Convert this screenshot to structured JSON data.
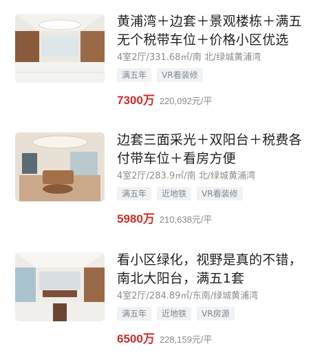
{
  "listings": [
    {
      "title": "黄浦湾＋边套＋景观楼栋＋满五无个税带车位＋价格小区优选",
      "meta": "4室2厅/331.68㎡/南 北/绿城黄浦湾",
      "tags": [
        "满五年",
        "VR看装修"
      ],
      "price": "7300万",
      "unit_price": "220,092元/平"
    },
    {
      "title": "边套三面采光＋双阳台＋税费各付带车位＋看房方便",
      "meta": "4室2厅/283.9㎡/南 北/绿城黄浦湾",
      "tags": [
        "满五年",
        "近地铁",
        "VR看装修"
      ],
      "price": "5980万",
      "unit_price": "210,638元/平"
    },
    {
      "title": "看小区绿化，视野是真的不错，南北大阳台，满五1套",
      "meta": "4室2厅/284.89㎡/东南/绿城黄浦湾",
      "tags": [
        "满五年",
        "近地铁",
        "VR房源"
      ],
      "price": "6500万",
      "unit_price": "228,159元/平"
    }
  ]
}
